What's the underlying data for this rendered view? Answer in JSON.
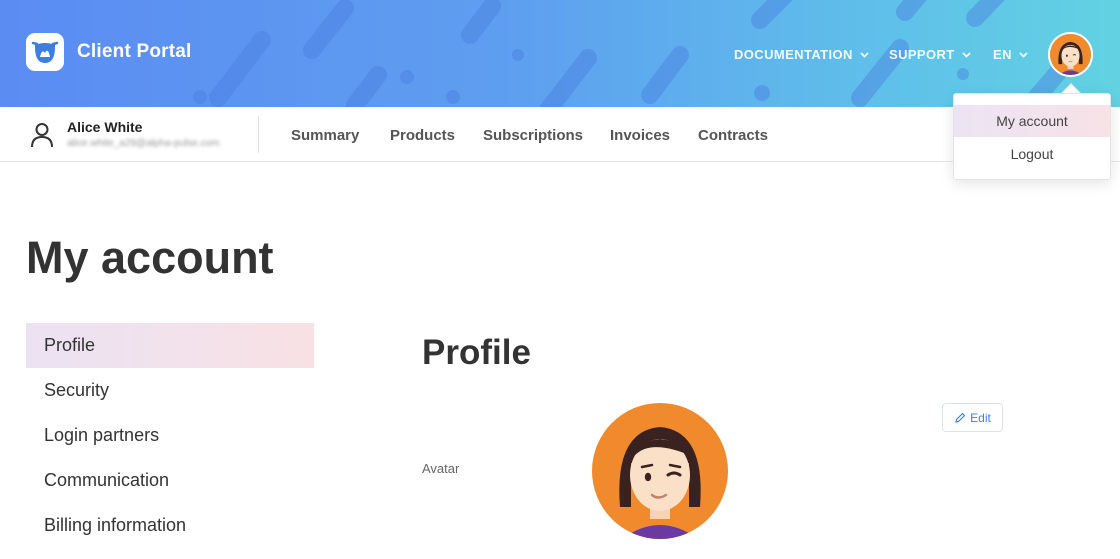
{
  "header": {
    "app_title": "Client Portal",
    "links": [
      {
        "label": "DOCUMENTATION"
      },
      {
        "label": "SUPPORT"
      },
      {
        "label": "EN"
      }
    ],
    "gradient_colors": [
      "#5b8cf2",
      "#62d2e2"
    ]
  },
  "user": {
    "name": "Alice White",
    "email": "alice.white_a29@alpha-pulse.com"
  },
  "nav": {
    "items": [
      "Summary",
      "Products",
      "Subscriptions",
      "Invoices",
      "Contracts"
    ]
  },
  "dropdown": {
    "items": [
      {
        "label": "My account",
        "active": true
      },
      {
        "label": "Logout",
        "active": false
      }
    ]
  },
  "page": {
    "title": "My account"
  },
  "sidebar": {
    "items": [
      {
        "label": "Profile",
        "active": true
      },
      {
        "label": "Security",
        "active": false
      },
      {
        "label": "Login partners",
        "active": false
      },
      {
        "label": "Communication",
        "active": false
      },
      {
        "label": "Billing information",
        "active": false
      }
    ]
  },
  "profile": {
    "section_title": "Profile",
    "avatar_label": "Avatar",
    "edit_label": "Edit"
  },
  "colors": {
    "accent": "#3d7fe0",
    "avatar_bg": "#f08a2c",
    "active_gradient": [
      "#ebe2f3",
      "#f8e1e4"
    ]
  }
}
